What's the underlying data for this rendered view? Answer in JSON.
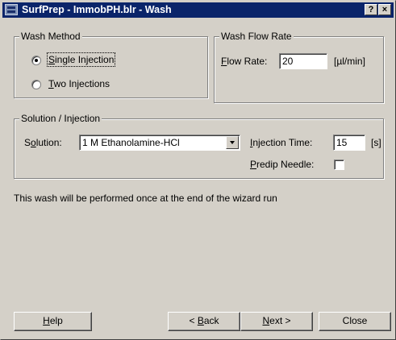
{
  "window": {
    "title": "SurfPrep - ImmobPH.blr - Wash",
    "help_btn": "?",
    "close_btn": "×"
  },
  "wash_method": {
    "legend": "Wash Method",
    "options": [
      {
        "prefix": "",
        "accel": "S",
        "rest": "ingle Injection",
        "checked": true
      },
      {
        "prefix": "",
        "accel": "T",
        "rest": "wo Injections",
        "checked": false
      }
    ]
  },
  "flow_rate": {
    "legend": "Wash Flow Rate",
    "label_accel": "F",
    "label_rest": "low Rate:",
    "value": "20",
    "unit": "[µl/min]"
  },
  "solution_injection": {
    "legend": "Solution / Injection",
    "solution_label_pre": "S",
    "solution_label_accel": "o",
    "solution_label_rest": "lution:",
    "solution_value": "1 M Ethanolamine-HCl",
    "injection_time_accel": "I",
    "injection_time_rest": "njection Time:",
    "injection_time_value": "15",
    "injection_time_unit": "[s]",
    "predip_accel": "P",
    "predip_rest": "redip Needle:",
    "predip_checked": false
  },
  "info_text": "This wash will be performed once at the end of the wizard run",
  "buttons": {
    "help_accel": "H",
    "help_rest": "elp",
    "back_pre": "< ",
    "back_accel": "B",
    "back_rest": "ack",
    "next_accel": "N",
    "next_rest": "ext >",
    "close": "Close"
  }
}
